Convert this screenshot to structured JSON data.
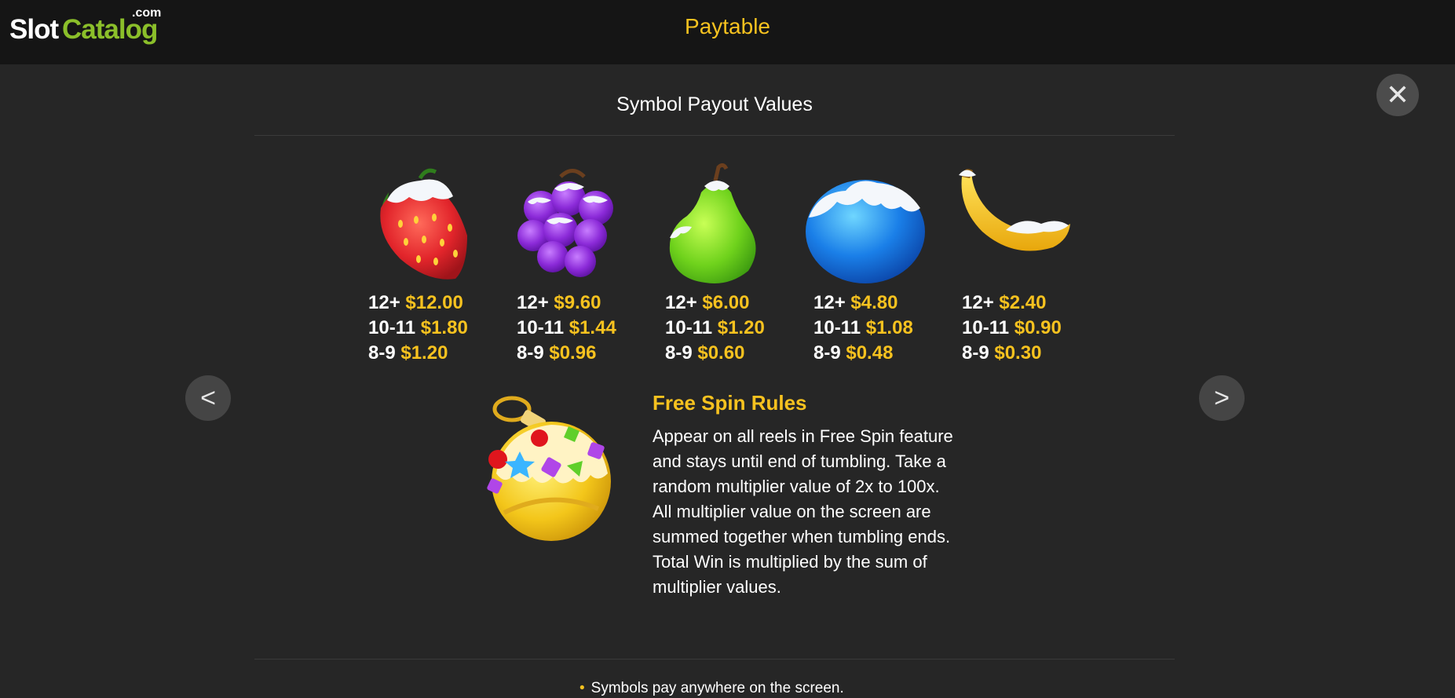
{
  "header": {
    "logo": {
      "part1": "Slot",
      "part2": "Catalog",
      "suffix": ".com"
    },
    "title": "Paytable"
  },
  "section_title": "Symbol Payout Values",
  "close_icon": "✕",
  "nav": {
    "prev": "<",
    "next": ">"
  },
  "symbols": [
    {
      "icon": "strawberry-icon",
      "pays": [
        {
          "count": "12+",
          "value": "$12.00"
        },
        {
          "count": "10-11",
          "value": "$1.80"
        },
        {
          "count": "8-9",
          "value": "$1.20"
        }
      ]
    },
    {
      "icon": "grapes-icon",
      "pays": [
        {
          "count": "12+",
          "value": "$9.60"
        },
        {
          "count": "10-11",
          "value": "$1.44"
        },
        {
          "count": "8-9",
          "value": "$0.96"
        }
      ]
    },
    {
      "icon": "pear-icon",
      "pays": [
        {
          "count": "12+",
          "value": "$6.00"
        },
        {
          "count": "10-11",
          "value": "$1.20"
        },
        {
          "count": "8-9",
          "value": "$0.60"
        }
      ]
    },
    {
      "icon": "blueberry-icon",
      "pays": [
        {
          "count": "12+",
          "value": "$4.80"
        },
        {
          "count": "10-11",
          "value": "$1.08"
        },
        {
          "count": "8-9",
          "value": "$0.48"
        }
      ]
    },
    {
      "icon": "banana-icon",
      "pays": [
        {
          "count": "12+",
          "value": "$2.40"
        },
        {
          "count": "10-11",
          "value": "$0.90"
        },
        {
          "count": "8-9",
          "value": "$0.30"
        }
      ]
    }
  ],
  "free_spin": {
    "icon": "christmas-ornament-icon",
    "title": "Free Spin Rules",
    "lines": [
      "Appear on all reels in Free Spin feature",
      "and stays until end of tumbling. Take a",
      "random multiplier value of 2x to 100x.",
      "All multiplier value on the screen are",
      "summed together when tumbling ends.",
      "Total Win is multiplied by the sum of",
      "multiplier values."
    ]
  },
  "rules": [
    "Symbols pay anywhere on the screen."
  ]
}
